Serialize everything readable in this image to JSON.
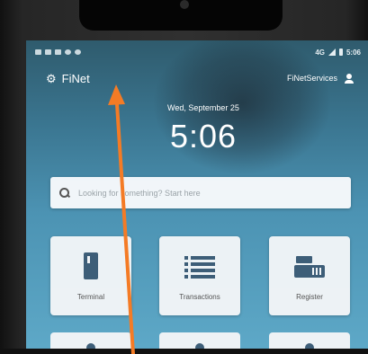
{
  "status_bar": {
    "network": "4G",
    "time": "5:06"
  },
  "app_bar": {
    "app_name": "FiNet",
    "account_name": "FiNetServices"
  },
  "lock_clock": {
    "date": "Wed, September 25",
    "time": "5:06"
  },
  "search": {
    "placeholder": "Looking for something? Start here"
  },
  "tiles": [
    {
      "label": "Terminal",
      "icon": "terminal-icon"
    },
    {
      "label": "Transactions",
      "icon": "list-icon"
    },
    {
      "label": "Register",
      "icon": "cash-register-icon"
    }
  ],
  "annotation": {
    "arrow_color": "#f47b25"
  },
  "colors": {
    "screen_top": "#2f5b6d",
    "screen_bottom": "#5ea9c8",
    "tile_icon": "#3d5e78"
  }
}
